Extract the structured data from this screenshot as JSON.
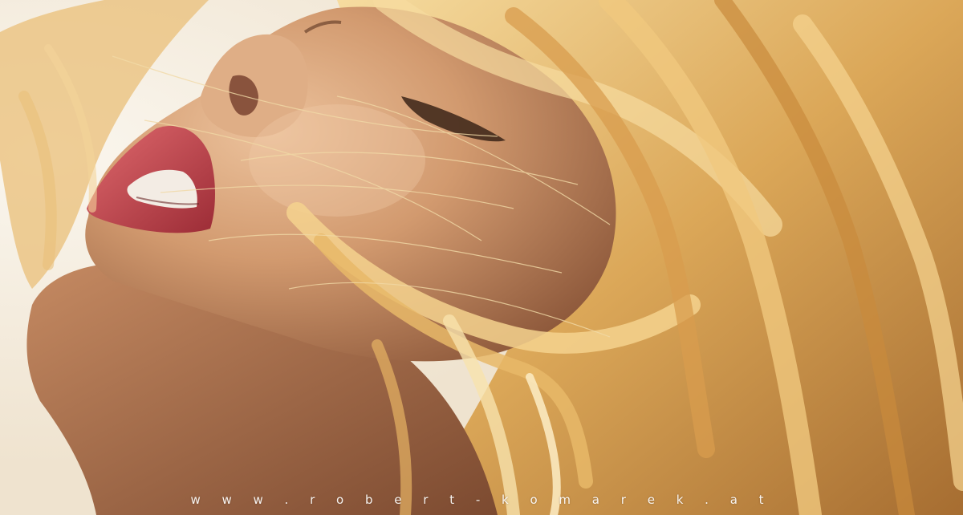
{
  "photo": {
    "subject": "portrait",
    "watermark": "w w w . r o b e r t - k o m a r e k . a t",
    "colors": {
      "background": "#f3ece0",
      "skin_light": "#e3b48f",
      "skin_mid": "#c98d63",
      "skin_shadow": "#8a5538",
      "lips": "#c8434b",
      "hair_light": "#f4d28e",
      "hair_mid": "#dba758",
      "hair_dark": "#8b5a26"
    }
  }
}
